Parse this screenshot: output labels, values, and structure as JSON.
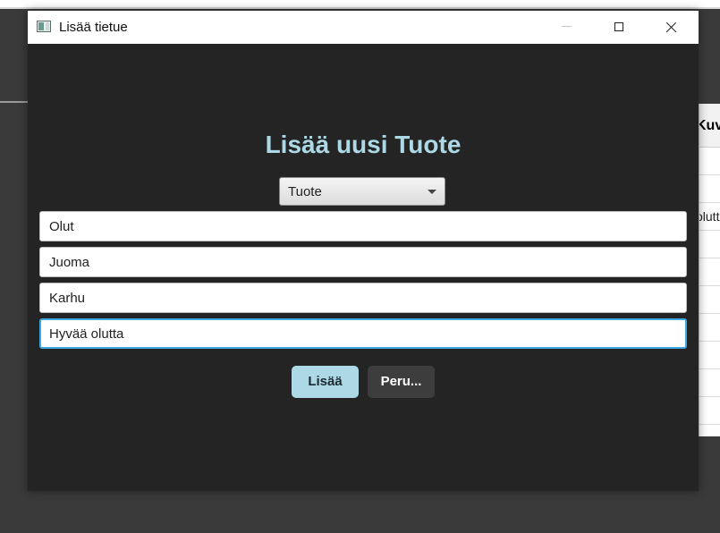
{
  "background_app": {
    "table": {
      "header": "Kuv",
      "rows": [
        "",
        "",
        "olutt",
        "",
        "",
        "",
        "",
        "",
        "",
        ""
      ]
    }
  },
  "dialog": {
    "title": "Lisää tietue",
    "heading": "Lisää uusi Tuote",
    "type_select": {
      "value": "Tuote"
    },
    "fields": [
      {
        "value": "Olut"
      },
      {
        "value": "Juoma"
      },
      {
        "value": "Karhu"
      },
      {
        "value": "Hyvää olutta"
      }
    ],
    "buttons": {
      "add_label": "Lisää",
      "cancel_label": "Peru..."
    }
  },
  "colors": {
    "accent": "#add8e6",
    "dialog_bg": "#242424",
    "focus_border": "#3fa9e6"
  },
  "icons": {
    "app": "window-app-icon",
    "minimize": "minimize-icon",
    "maximize": "maximize-icon",
    "close": "close-icon",
    "dropdown": "chevron-down-icon"
  }
}
